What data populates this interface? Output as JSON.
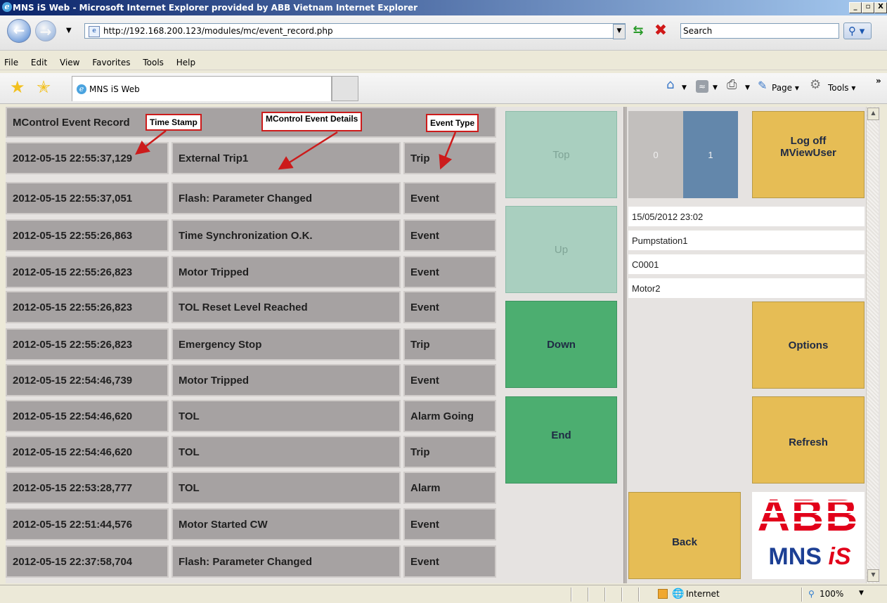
{
  "window": {
    "title": "MNS iS Web - Microsoft Internet Explorer provided by ABB Vietnam Internet Explorer",
    "min": "_",
    "max": "▫",
    "close": "X"
  },
  "address": {
    "url": "http://192.168.200.123/modules/mc/event_record.php",
    "search_placeholder": "Search"
  },
  "menu": [
    "File",
    "Edit",
    "View",
    "Favorites",
    "Tools",
    "Help"
  ],
  "tab": {
    "label": "MNS iS Web"
  },
  "commands": {
    "page": "Page",
    "tools": "Tools"
  },
  "record": {
    "title": "MControl Event Record",
    "rows": [
      {
        "time": "2012-05-15 22:55:37,129",
        "details": "External Trip1",
        "type": "Trip"
      },
      {
        "time": "2012-05-15 22:55:37,051",
        "details": "Flash: Parameter Changed",
        "type": "Event"
      },
      {
        "time": "2012-05-15 22:55:26,863",
        "details": "Time Synchronization O.K.",
        "type": "Event"
      },
      {
        "time": "2012-05-15 22:55:26,823",
        "details": "Motor Tripped",
        "type": "Event"
      },
      {
        "time": "2012-05-15 22:55:26,823",
        "details": "TOL Reset Level Reached",
        "type": "Event"
      },
      {
        "time": "2012-05-15 22:55:26,823",
        "details": "Emergency Stop",
        "type": "Trip"
      },
      {
        "time": "2012-05-15 22:54:46,739",
        "details": "Motor Tripped",
        "type": "Event"
      },
      {
        "time": "2012-05-15 22:54:46,620",
        "details": "TOL",
        "type": "Alarm Going"
      },
      {
        "time": "2012-05-15 22:54:46,620",
        "details": "TOL",
        "type": "Trip"
      },
      {
        "time": "2012-05-15 22:53:28,777",
        "details": "TOL",
        "type": "Alarm"
      },
      {
        "time": "2012-05-15 22:51:44,576",
        "details": "Motor Started CW",
        "type": "Event"
      },
      {
        "time": "2012-05-15 22:37:58,704",
        "details": "Flash: Parameter Changed",
        "type": "Event"
      }
    ]
  },
  "callouts": {
    "time_stamp": "Time Stamp",
    "details": "MControl Event Details",
    "event_type": "Event Type"
  },
  "nav": {
    "top": "Top",
    "up": "Up",
    "down": "Down",
    "end": "End"
  },
  "pager": {
    "page0": "0",
    "page1": "1"
  },
  "buttons": {
    "logoff_line1": "Log off",
    "logoff_line2": "MViewUser",
    "options": "Options",
    "refresh": "Refresh",
    "back": "Back"
  },
  "info": {
    "datetime": "15/05/2012 23:02",
    "station": "Pumpstation1",
    "controller": "C0001",
    "motor": "Motor2"
  },
  "logo": {
    "abb": "ABB",
    "mns": "MNS",
    "is": "iS"
  },
  "status": {
    "zone": "Internet",
    "zoom": "100%"
  },
  "colors": {
    "cell_gray": "#a6a2a2",
    "nav_disabled": "#a9cfbf",
    "nav_active": "#4cae70",
    "button_yellow": "#e6bd55",
    "pager_gray": "#c2bfbd",
    "pager_blue": "#6387ab",
    "callout_red": "#cc1b1b",
    "abb_red": "#e2001a",
    "mns_blue": "#1c3f94"
  },
  "icons": [
    "ie-icon",
    "back-arrow-icon",
    "forward-arrow-icon",
    "refresh-icon",
    "stop-icon",
    "search-icon",
    "star-icon",
    "add-favorite-icon",
    "home-icon",
    "feed-icon",
    "print-icon",
    "page-icon",
    "tools-gear-icon",
    "globe-icon",
    "zoom-icon"
  ]
}
